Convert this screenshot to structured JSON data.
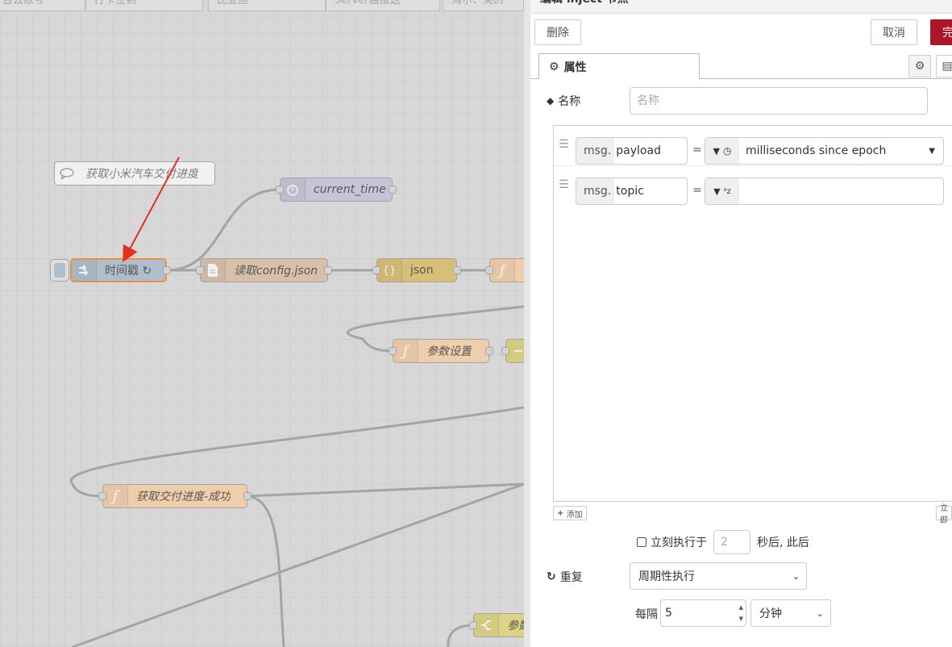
{
  "flow_tabs": [
    "台云账号",
    "打卡签到",
    "比亚迪",
    "Server酱推送",
    "海尔、美的"
  ],
  "comment": "获取小米汽车交付进度",
  "nodes": {
    "inject": "时间戳 ↻",
    "current_time": "current_time",
    "read_file": "读取config.json",
    "json": "json",
    "param": "参数设置",
    "progress": "获取交付进度-成功",
    "switch": "参数"
  },
  "panel": {
    "title": "编辑 inject 节点",
    "delete_label": "删除",
    "cancel_label": "取消",
    "done_label": "完",
    "tab_properties": "属性",
    "name_label": "名称",
    "name_placeholder": "名称",
    "props": [
      {
        "prefix": "msg.",
        "key": "payload",
        "type_value": "milliseconds since epoch"
      },
      {
        "prefix": "msg.",
        "key": "topic",
        "type_value": ""
      }
    ],
    "add_label": "添加",
    "inject_now_label": "立即",
    "once_label": "立刻执行于",
    "once_delay": "2",
    "once_suffix": "秒后, 此后",
    "repeat_label": "重复",
    "repeat_value": "周期性执行",
    "every_label": "每隔",
    "every_value": "5",
    "unit_value": "分钟"
  },
  "colors": {
    "done_button": "#ad1625",
    "annotation_arrow": "#e0301e",
    "wire": "#999999"
  }
}
